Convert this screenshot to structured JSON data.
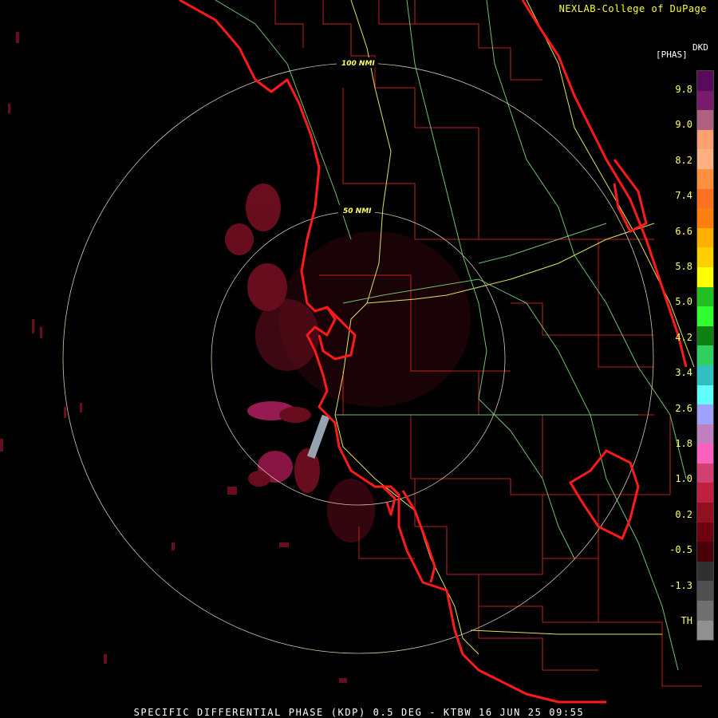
{
  "header": {
    "credit": "NEXLAB-College of DuPage"
  },
  "legend": {
    "unit": "[PHAS]",
    "product": "DKD",
    "labels": [
      "9.8",
      "9.0",
      "8.2",
      "7.4",
      "6.6",
      "5.8",
      "5.0",
      "4.2",
      "3.4",
      "2.6",
      "1.8",
      "1.0",
      "0.2",
      "-0.5",
      "-1.3",
      "TH"
    ],
    "colors": [
      "#5a0a5a",
      "#7a1a6a",
      "#b06080",
      "#ffa070",
      "#ffb080",
      "#ff9040",
      "#ff7020",
      "#ff8010",
      "#ffb000",
      "#ffd000",
      "#ffff00",
      "#20c020",
      "#30ff30",
      "#108010",
      "#30d060",
      "#30c0c0",
      "#60ffff",
      "#a0a0ff",
      "#c080c0",
      "#ff60c0",
      "#d04070",
      "#c02040",
      "#901020",
      "#700010",
      "#4a0008",
      "#303030",
      "#505050",
      "#707070",
      "#909090"
    ]
  },
  "rings": [
    {
      "label": "50 NMI"
    },
    {
      "label": "100 NMI"
    }
  ],
  "footer": {
    "caption": "SPECIFIC DIFFERENTIAL PHASE (KDP) 0.5 DEG - KTBW 16 JUN 25 09:55"
  }
}
